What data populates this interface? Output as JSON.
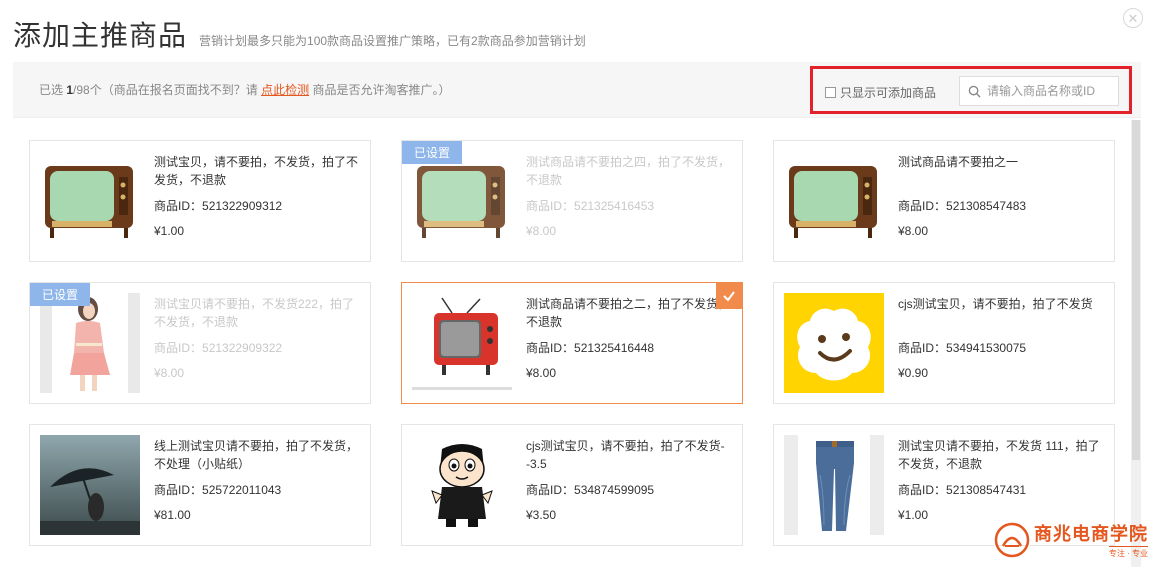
{
  "header": {
    "title": "添加主推商品",
    "subtitle": "营销计划最多只能为100款商品设置推广策略，已有2款商品参加营销计划"
  },
  "toolbar": {
    "selected_prefix": "已选",
    "selected_count": "1",
    "selected_total": "/98个",
    "hint_before": "（商品在报名页面找不到？请",
    "check_link": "点此检测",
    "hint_after": "商品是否允许淘客推广。）",
    "only_addable_label": "只显示可添加商品",
    "search_placeholder": "请输入商品名称或ID"
  },
  "labels": {
    "pid_prefix": "商品ID：",
    "set_badge": "已设置"
  },
  "products": [
    {
      "name": "测试宝贝，请不要拍，不发货，拍了不发货，不退款",
      "id": "521322909312",
      "price": "¥1.00",
      "state": "normal",
      "image": "vintage-tv"
    },
    {
      "name": "测试商品请不要拍之四，拍了不发货，不退款",
      "id": "521325416453",
      "price": "¥8.00",
      "state": "set",
      "image": "vintage-tv"
    },
    {
      "name": "测试商品请不要拍之一",
      "id": "521308547483",
      "price": "¥8.00",
      "state": "normal",
      "image": "vintage-tv"
    },
    {
      "name": "测试宝贝请不要拍，不发货222，拍了不发货，不退款",
      "id": "521322909322",
      "price": "¥8.00",
      "state": "set",
      "image": "woman-dress"
    },
    {
      "name": "测试商品请不要拍之二，拍了不发货，不退款",
      "id": "521325416448",
      "price": "¥8.00",
      "state": "selected",
      "image": "red-tv"
    },
    {
      "name": "cjs测试宝贝，请不要拍，拍了不发货",
      "id": "534941530075",
      "price": "¥0.90",
      "state": "normal",
      "image": "smiley-face"
    },
    {
      "name": "线上测试宝贝请不要拍，拍了不发货，不处理（小贴纸）",
      "id": "525722011043",
      "price": "¥81.00",
      "state": "normal",
      "image": "umbrella-person"
    },
    {
      "name": "cjs测试宝贝，请不要拍，拍了不发货--3.5",
      "id": "534874599095",
      "price": "¥3.50",
      "state": "normal",
      "image": "cartoon-boy"
    },
    {
      "name": "测试宝贝请不要拍，不发货 111，拍了不发货，不退款",
      "id": "521308547431",
      "price": "¥1.00",
      "state": "normal",
      "image": "jeans"
    }
  ],
  "watermark": {
    "brand": "商兆电商学院",
    "tagline": "专注 · 专业"
  },
  "colors": {
    "accent": "#f08b4b",
    "link": "#e4571e",
    "badge": "#8fb6ea",
    "highlight_box": "#e2212b"
  }
}
